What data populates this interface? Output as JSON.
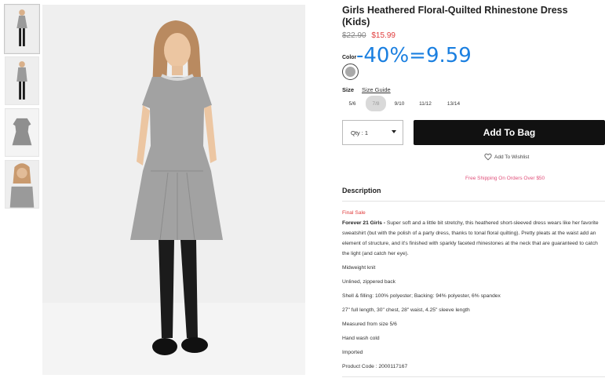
{
  "product": {
    "title": "Girls Heathered Floral-Quilted Rhinestone Dress (Kids)",
    "price_original": "$22.90",
    "price_sale": "$15.99",
    "overlay_text": "-40%=9.59"
  },
  "color": {
    "label": "Color",
    "selected_swatch": "#a9a9a9"
  },
  "size": {
    "label": "Size",
    "guide_label": "Size Guide",
    "options": [
      "5/6",
      "7/8",
      "9/10",
      "11/12",
      "13/14"
    ],
    "selected": "7/8"
  },
  "qty": {
    "label": "Qty : 1"
  },
  "actions": {
    "add_to_bag": "Add To Bag",
    "wishlist": "Add To Wishlist",
    "free_shipping": "Free Shipping On Orders Over $50"
  },
  "description": {
    "heading": "Description",
    "final_sale": "Final Sale",
    "brand": "Forever 21 Girls -",
    "body": "Super soft and a little bit stretchy, this heathered short-sleeved dress wears like her favorite sweatshirt (but with the polish of a party dress, thanks to tonal floral quilting). Pretty pleats at the waist add an element of structure, and it's finished with sparkly faceted rhinestones at the neck that are guaranteed to catch the light (and catch her eye).",
    "details": [
      "Midweight knit",
      "Unlined, zippered back",
      "Shell & filling: 100% polyester; Backing: 94% polyester, 6% spandex",
      "27\" full length, 30\" chest, 28\" waist, 4.25\" sleeve length",
      "Measured from size 5/6",
      "Hand wash cold",
      "Imported",
      "Product Code : 2000117167"
    ]
  },
  "colors": {
    "accent_red": "#e03c3c",
    "overlay_blue": "#1a7fe0",
    "button_black": "#111111",
    "ship_pink": "#e0507a"
  }
}
